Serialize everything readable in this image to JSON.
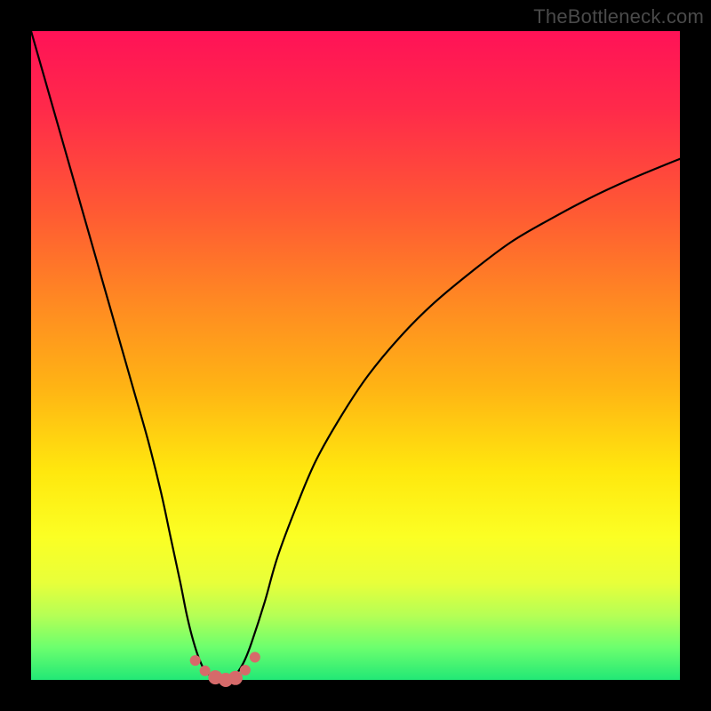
{
  "watermark": "TheBottleneck.com",
  "chart_data": {
    "type": "line",
    "title": "",
    "xlabel": "",
    "ylabel": "",
    "xlim": [
      0,
      100
    ],
    "ylim": [
      0,
      100
    ],
    "series": [
      {
        "name": "left-curve",
        "x": [
          0,
          2,
          4,
          6,
          8,
          10,
          12,
          14,
          16,
          18,
          20,
          21.5,
          23,
          24,
          25,
          26,
          27,
          28.5,
          30
        ],
        "y": [
          100,
          93,
          86,
          79,
          72,
          65,
          58,
          51,
          44,
          37,
          29,
          22,
          15,
          10,
          6,
          3,
          1.2,
          0.3,
          0
        ]
      },
      {
        "name": "right-curve",
        "x": [
          30,
          31,
          32,
          33,
          34,
          36,
          38,
          41,
          44,
          48,
          52,
          57,
          62,
          68,
          74,
          80,
          86,
          92,
          98,
          100
        ],
        "y": [
          0,
          0.4,
          1.4,
          3.2,
          5.8,
          12,
          19,
          27,
          34,
          41,
          47,
          53,
          58,
          63,
          67.5,
          71,
          74.2,
          77,
          79.5,
          80.3
        ]
      }
    ],
    "markers": {
      "name": "bottom-dots",
      "color": "#d66a6a",
      "points": [
        {
          "x": 25.3,
          "y": 3.0,
          "r": 6
        },
        {
          "x": 26.8,
          "y": 1.4,
          "r": 6
        },
        {
          "x": 28.4,
          "y": 0.4,
          "r": 8
        },
        {
          "x": 30.0,
          "y": 0.0,
          "r": 8
        },
        {
          "x": 31.5,
          "y": 0.3,
          "r": 8
        },
        {
          "x": 33.0,
          "y": 1.5,
          "r": 6
        },
        {
          "x": 34.5,
          "y": 3.5,
          "r": 6
        }
      ]
    }
  }
}
